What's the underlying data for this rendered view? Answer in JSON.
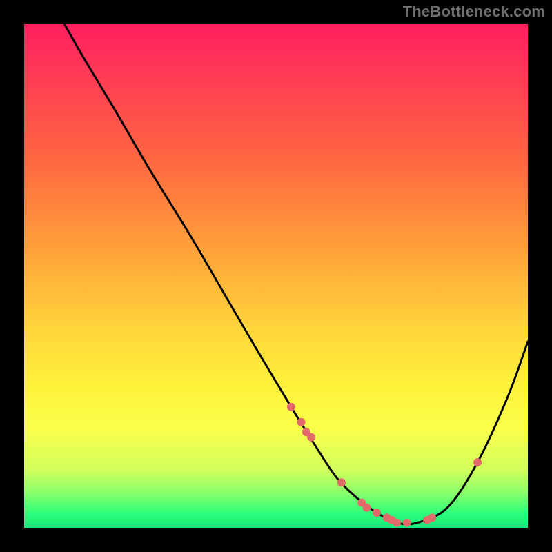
{
  "watermark": "TheBottleneck.com",
  "chart_data": {
    "type": "line",
    "title": "",
    "xlabel": "",
    "ylabel": "",
    "xlim": [
      0,
      100
    ],
    "ylim": [
      0,
      100
    ],
    "curve": {
      "name": "bottleneck-curve",
      "x": [
        8,
        12,
        18,
        25,
        33,
        40,
        47,
        53,
        58,
        62,
        66,
        70,
        74,
        78,
        84,
        90,
        96,
        100
      ],
      "y": [
        100,
        93,
        83,
        71,
        58,
        46,
        34,
        24,
        16,
        10,
        6,
        3,
        1,
        1,
        4,
        13,
        26,
        37
      ]
    },
    "markers": {
      "name": "highlight-points",
      "color": "#e36a6a",
      "x": [
        53,
        55,
        56,
        57,
        63,
        67,
        68,
        70,
        72,
        73,
        74,
        76,
        80,
        81,
        90
      ],
      "y": [
        24,
        21,
        19,
        18,
        9,
        5,
        4,
        3,
        2,
        1.5,
        1,
        1,
        1.5,
        2,
        13
      ]
    },
    "gradient_stops": [
      {
        "pos": 0,
        "color": "#ff2060"
      },
      {
        "pos": 45,
        "color": "#ffa23a"
      },
      {
        "pos": 72,
        "color": "#fff23a"
      },
      {
        "pos": 100,
        "color": "#16e97c"
      }
    ]
  }
}
